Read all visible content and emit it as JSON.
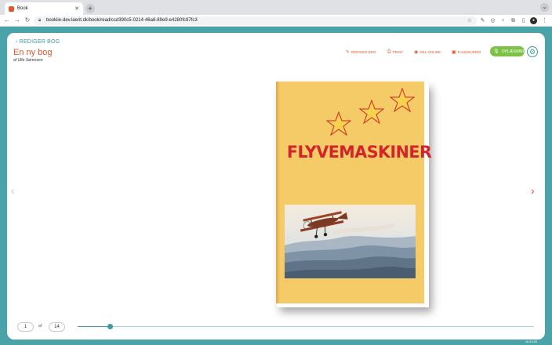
{
  "browser": {
    "tab_title": "Book",
    "url": "bookiie-dev.laerit.dk/book/read/ccd390c5-0214-46a8-89e9-e4280fc97fc3"
  },
  "header": {
    "back_label": "REDIGER BOG",
    "title": "En ny bog",
    "author": "af Ulfe Sørensen"
  },
  "actions": [
    {
      "label": "REDIGER BOG",
      "icon": "pencil-icon"
    },
    {
      "label": "PRINT",
      "icon": "printer-icon"
    },
    {
      "label": "DEL ONLINE",
      "icon": "globe-icon"
    },
    {
      "label": "FULDSKÆRM",
      "icon": "fullscreen-icon"
    }
  ],
  "read_aloud": {
    "label": "OPLÆSNING",
    "icon": "microphone-icon"
  },
  "cover": {
    "title": "FLYVEMASKINER"
  },
  "pager": {
    "current": "1",
    "of_label": "af",
    "total": "14",
    "progress": 0.071
  },
  "version": "v0.8.181",
  "colors": {
    "accent": "#e0572c",
    "teal": "#3d9aa1",
    "green": "#7cc244",
    "cover_bg": "#f4cb67",
    "cover_title": "#d4232a",
    "background": "#4aa3a8"
  }
}
